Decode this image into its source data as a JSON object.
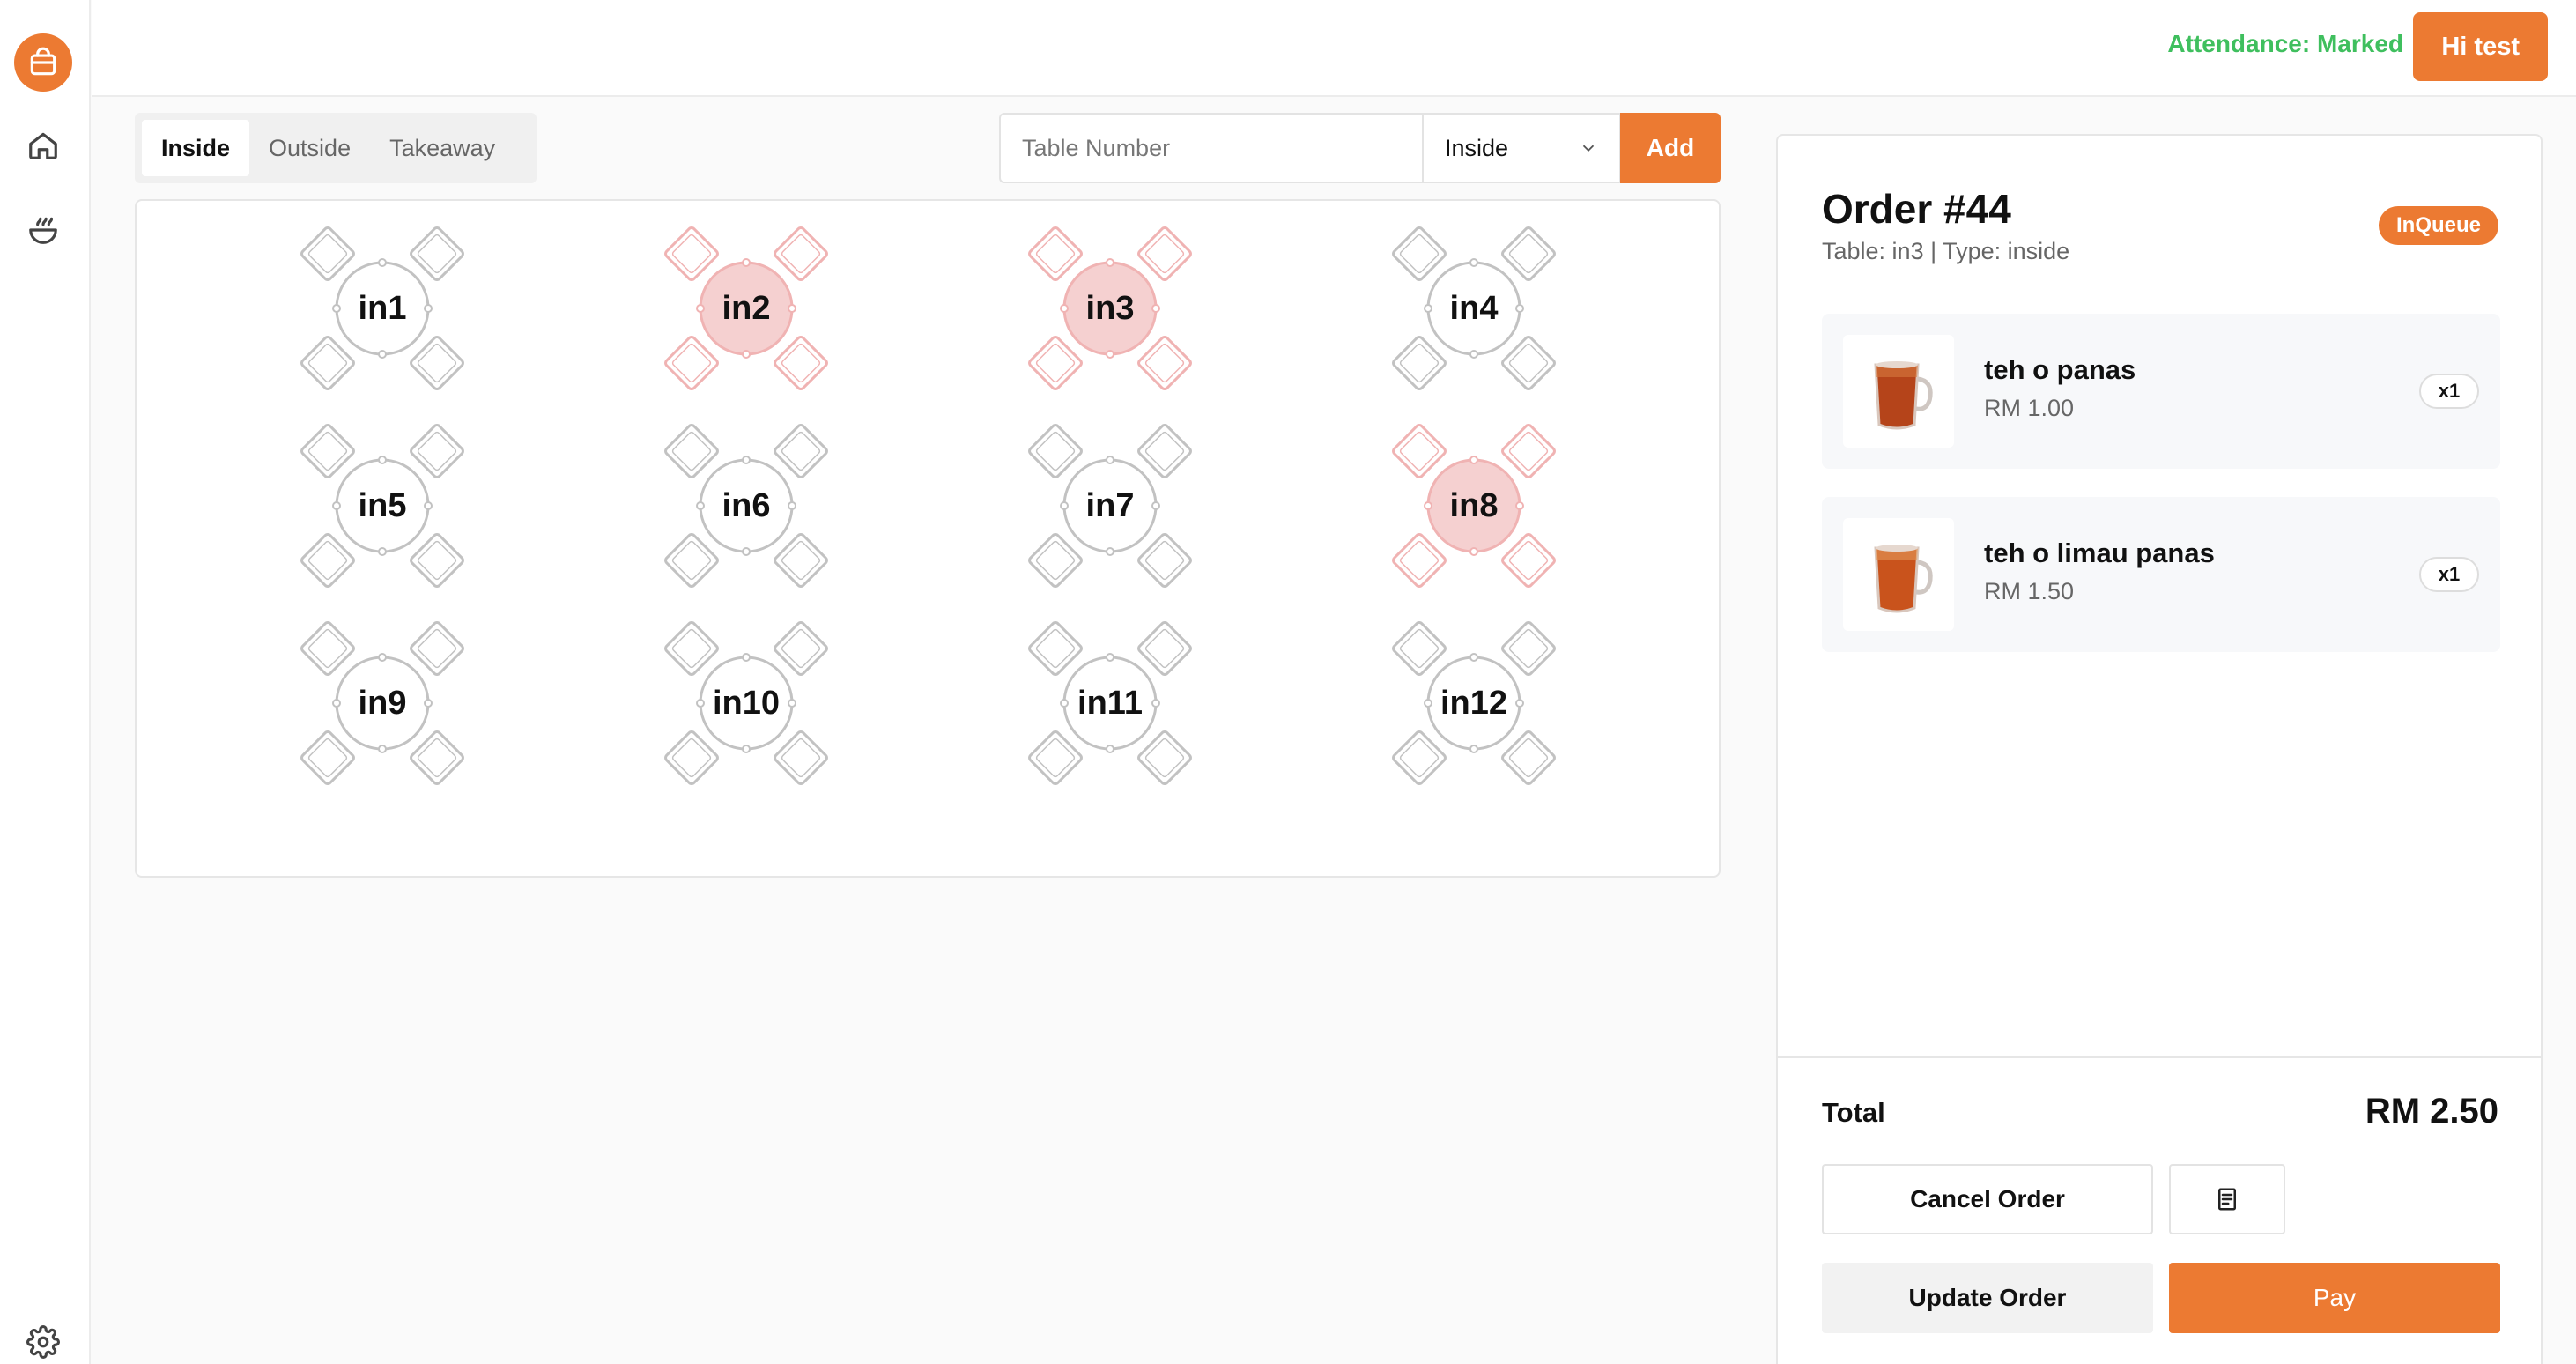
{
  "sidebar": {
    "items": [
      {
        "icon": "shopping-bag-icon",
        "active": true
      },
      {
        "icon": "home-icon",
        "active": false
      },
      {
        "icon": "food-bowl-icon",
        "active": false
      }
    ],
    "bottom_icon": "settings-icon"
  },
  "header": {
    "attendance": "Attendance: Marked",
    "user_button": "Hi test"
  },
  "tabs": [
    {
      "label": "Inside",
      "active": true
    },
    {
      "label": "Outside",
      "active": false
    },
    {
      "label": "Takeaway",
      "active": false
    }
  ],
  "add_table": {
    "placeholder": "Table Number",
    "type_selected": "Inside",
    "add_label": "Add"
  },
  "tables": [
    {
      "label": "in1",
      "occupied": false
    },
    {
      "label": "in2",
      "occupied": true
    },
    {
      "label": "in3",
      "occupied": true
    },
    {
      "label": "in4",
      "occupied": false
    },
    {
      "label": "in5",
      "occupied": false
    },
    {
      "label": "in6",
      "occupied": false
    },
    {
      "label": "in7",
      "occupied": false
    },
    {
      "label": "in8",
      "occupied": true
    },
    {
      "label": "in9",
      "occupied": false
    },
    {
      "label": "in10",
      "occupied": false
    },
    {
      "label": "in11",
      "occupied": false
    },
    {
      "label": "in12",
      "occupied": false
    }
  ],
  "order": {
    "title": "Order #44",
    "subtitle": "Table: in3 | Type: inside",
    "status": "InQueue",
    "items": [
      {
        "name": "teh o panas",
        "price": "RM 1.00",
        "qty": "x1",
        "image_icon": "tea-glass-icon"
      },
      {
        "name": "teh o limau panas",
        "price": "RM 1.50",
        "qty": "x1",
        "image_icon": "tea-glass-icon"
      }
    ],
    "total_label": "Total",
    "total_value": "RM 2.50",
    "cancel_label": "Cancel Order",
    "receipt_icon": "receipt-icon",
    "update_label": "Update Order",
    "pay_label": "Pay"
  },
  "colors": {
    "accent": "#ec7a32",
    "attendance": "#3fbf5e",
    "occupied_fill": "#f5d0d0",
    "occupied_stroke": "#f0b3b3",
    "free_stroke": "#c2c2c2"
  }
}
